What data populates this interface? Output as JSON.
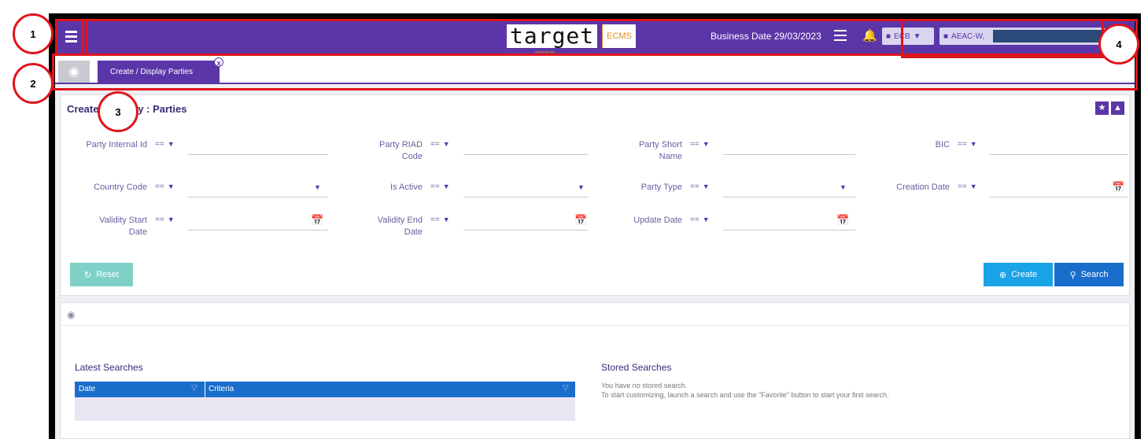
{
  "header": {
    "logo_main": "target",
    "logo_sub": "services",
    "logo_ecms": "ECMS",
    "business_date": "Business Date 29/03/2023",
    "ecb_label": "ECB",
    "user_label": "AEAC-W,"
  },
  "tabs": {
    "active_label": "Create / Display Parties",
    "close_glyph": "x"
  },
  "panel": {
    "title": "Create / Display : Parties",
    "operator": "=="
  },
  "fields": {
    "party_internal_id": "Party Internal Id",
    "party_riad_code_1": "Party RIAD",
    "party_riad_code_2": "Code",
    "party_short_name_1": "Party Short",
    "party_short_name_2": "Name",
    "bic": "BIC",
    "country_code": "Country Code",
    "is_active": "Is Active",
    "party_type": "Party Type",
    "creation_date": "Creation Date",
    "validity_start_1": "Validity Start",
    "validity_start_2": "Date",
    "validity_end_1": "Validity End",
    "validity_end_2": "Date",
    "update_date": "Update Date"
  },
  "buttons": {
    "reset": "Reset",
    "create": "Create",
    "search": "Search"
  },
  "dashboard": {
    "latest_title": "Latest Searches",
    "stored_title": "Stored Searches",
    "col_date": "Date",
    "col_criteria": "Criteria",
    "stored_line1": "You have no stored search.",
    "stored_line2": "To start customizing, launch a search and use the \"Favorite\" button to start your first search."
  },
  "annotations": {
    "n1": "1",
    "n2": "2",
    "n3": "3",
    "n4": "4",
    "color": "#e0141c"
  },
  "colors": {
    "primary": "#5b36a8",
    "create": "#1aa3e6",
    "search": "#1a6ecb",
    "reset": "#7fd1c8"
  }
}
